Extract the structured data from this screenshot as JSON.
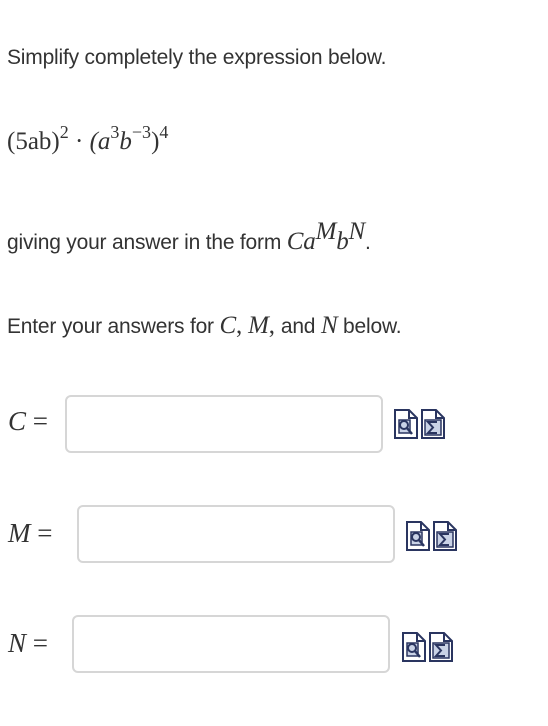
{
  "instruction": {
    "line1": "Simplify completely the expression below.",
    "line2_prefix": "giving your answer in the form ",
    "line3_prefix": "Enter your answers for ",
    "line3_suffix": " below."
  },
  "expression": {
    "part1_base": "(5ab)",
    "part1_exp": "2",
    "dot": " · ",
    "part2_open": "(a",
    "part2_exp_a": "3",
    "part2_b": "b",
    "part2_exp_b": "−3",
    "part2_close": ")",
    "part2_exp": "4"
  },
  "form": {
    "C": "C",
    "a": "a",
    "M": "M",
    "b": "b",
    "N": "N",
    "period": "."
  },
  "vars_list": {
    "C": "C",
    "comma1": ", ",
    "M": "M",
    "comma2": ", ",
    "and": "and",
    "N": "N"
  },
  "fields": [
    {
      "var": "C",
      "eq": " =",
      "value": ""
    },
    {
      "var": "M",
      "eq": " =",
      "value": ""
    },
    {
      "var": "N",
      "eq": " =",
      "value": ""
    }
  ],
  "icons": [
    "preview-icon",
    "equation-editor-icon"
  ],
  "colors": {
    "text": "#333333",
    "input_border": "#d6d6d6",
    "icon_bg": "#ffffff",
    "icon_border": "#2a3560"
  }
}
